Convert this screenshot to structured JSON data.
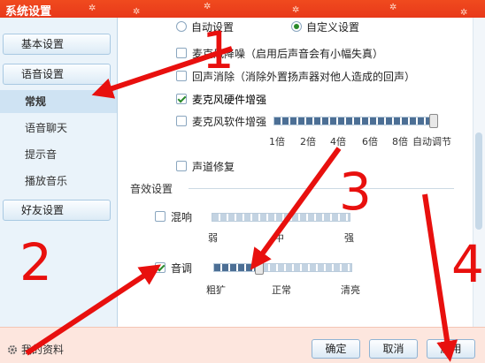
{
  "window": {
    "title": "系统设置"
  },
  "sidebar": {
    "groups": [
      {
        "label": "基本设置"
      },
      {
        "label": "语音设置"
      },
      {
        "label": "好友设置"
      }
    ],
    "sub_items": [
      {
        "label": "常规",
        "active": true
      },
      {
        "label": "语音聊天"
      },
      {
        "label": "提示音"
      },
      {
        "label": "播放音乐"
      }
    ]
  },
  "options": {
    "auto_setting": {
      "label": "自动设置",
      "selected": false
    },
    "custom_setting": {
      "label": "自定义设置",
      "selected": true
    },
    "mic_noise": {
      "label": "麦克风降噪（启用后声音会有小幅失真）",
      "checked": false
    },
    "echo_cancel": {
      "label": "回声消除（消除外置扬声器对他人造成的回声）",
      "checked": false
    },
    "mic_hw_boost": {
      "label": "麦克风硬件增强",
      "checked": true
    },
    "mic_sw_boost": {
      "label": "麦克风软件增强",
      "checked": false,
      "level": 1.0
    },
    "mic_sw_ticks": [
      "1倍",
      "2倍",
      "4倍",
      "6倍",
      "8倍",
      "自动调节"
    ],
    "channel_fix": {
      "label": "声道修复",
      "checked": false
    }
  },
  "sound_effects": {
    "title": "音效设置",
    "reverb": {
      "label": "混响",
      "checked": false,
      "level": 0.0,
      "ticks": [
        "弱",
        "中",
        "强"
      ]
    },
    "pitch": {
      "label": "音调",
      "checked": true,
      "level": 0.33,
      "ticks": [
        "粗犷",
        "正常",
        "清亮"
      ]
    }
  },
  "bottom": {
    "profile_link": "我的资料",
    "ok": "确定",
    "cancel": "取消",
    "apply": "应用"
  },
  "annotations": [
    "1",
    "2",
    "3",
    "4"
  ],
  "colors": {
    "titlebar": "#e8391a",
    "annotation": "#e8100e",
    "check": "#2a8a2a"
  }
}
